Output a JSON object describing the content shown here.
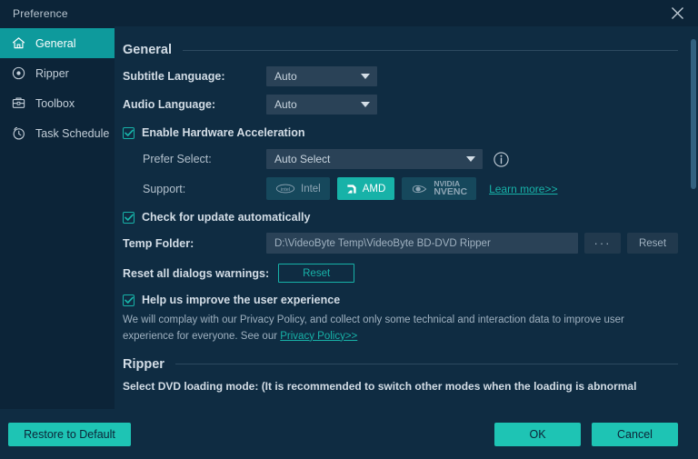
{
  "window": {
    "title": "Preference",
    "close_icon": "close-icon"
  },
  "sidebar": {
    "items": [
      {
        "label": "General",
        "icon": "home-icon",
        "active": true
      },
      {
        "label": "Ripper",
        "icon": "disc-icon",
        "active": false
      },
      {
        "label": "Toolbox",
        "icon": "toolbox-icon",
        "active": false
      },
      {
        "label": "Task Schedule",
        "icon": "clock-icon",
        "active": false
      }
    ]
  },
  "general": {
    "section_title": "General",
    "subtitle_language": {
      "label": "Subtitle Language:",
      "value": "Auto"
    },
    "audio_language": {
      "label": "Audio Language:",
      "value": "Auto"
    },
    "hw_accel": {
      "label": "Enable Hardware Acceleration",
      "checked": true
    },
    "prefer_select": {
      "label": "Prefer Select:",
      "value": "Auto Select",
      "info_icon": "info-icon"
    },
    "support": {
      "label": "Support:",
      "badges": [
        {
          "name": "Intel",
          "icon": "intel-logo-icon",
          "active": false
        },
        {
          "name": "AMD",
          "icon": "amd-logo-icon",
          "active": true
        },
        {
          "name": "NVIDIA",
          "name2": "NVENC",
          "icon": "nvidia-logo-icon",
          "active": false
        }
      ],
      "learn_more": "Learn more>>"
    },
    "auto_update": {
      "label": "Check for update automatically",
      "checked": true
    },
    "temp_folder": {
      "label": "Temp Folder:",
      "value": "D:\\VideoByte Temp\\VideoByte BD-DVD Ripper",
      "browse_label": "···",
      "reset_label": "Reset"
    },
    "reset_dialogs": {
      "label": "Reset all dialogs warnings:",
      "button": "Reset"
    },
    "improve": {
      "label": "Help us improve the user experience",
      "checked": true
    },
    "privacy_text_1": "We will complay with our Privacy Policy, and collect only some technical and interaction data to improve user experience for everyone. See our ",
    "privacy_link": "Privacy Policy>>"
  },
  "ripper": {
    "section_title": "Ripper",
    "note": "Select DVD loading mode: (It is recommended to switch other modes when the loading is abnormal"
  },
  "footer": {
    "restore": "Restore to Default",
    "ok": "OK",
    "cancel": "Cancel"
  },
  "colors": {
    "accent_teal": "#17b2a8",
    "button_teal": "#1ec4b4",
    "sidebar_active": "#0e9a9c",
    "bg_main": "#0f2c42",
    "bg_sidebar": "#0c2438",
    "field": "#2a4257"
  }
}
